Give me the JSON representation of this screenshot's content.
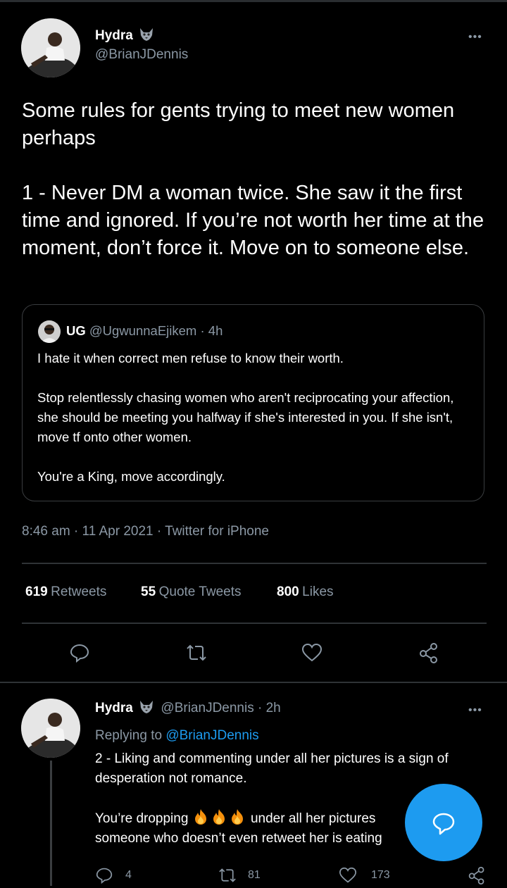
{
  "tweet": {
    "author_name": "Hydra",
    "author_handle": "@BrianJDennis",
    "more_label": "•••",
    "text": "Some rules for gents trying to meet new women perhaps\n\n1 - Never DM a woman twice. She saw it the first time and ignored. If you’re not worth her time at the moment, don’t force it. Move on to someone else.",
    "quoted": {
      "author_name": "UG",
      "author_handle": "@UgwunnaEjikem",
      "time": "· 4h",
      "text": "I hate it when correct men refuse to know their worth.\n\nStop relentlessly chasing women who aren't reciprocating your affection, she should be meeting you halfway if she's interested in you. If she isn't, move tf onto other women.\n\nYou're a King, move accordingly."
    },
    "timestamp": "8:46 am · 11 Apr 2021 · Twitter for iPhone",
    "stats": {
      "retweets": "619",
      "retweets_label": "Retweets",
      "quotes": "55",
      "quotes_label": "Quote Tweets",
      "likes": "800",
      "likes_label": "Likes"
    }
  },
  "reply": {
    "author_name": "Hydra",
    "author_handle": "@BrianJDennis",
    "time": "· 2h",
    "more_label": "•••",
    "replying_prefix": "Replying to",
    "replying_handle": "@BrianJDennis",
    "line1": "2 - Liking and commenting under all her pictures is a sign of",
    "line2": "desperation not romance.",
    "line3_a": "You’re dropping",
    "line3_b": "under all her pictures",
    "line4": "someone who doesn’t even retweet her is eating",
    "emoji": "fire-emoji",
    "counts": {
      "replies": "4",
      "retweets": "81",
      "likes": "173"
    }
  },
  "colors": {
    "accent": "#1d9bf0",
    "muted": "#8b98a5",
    "background": "#000000"
  }
}
